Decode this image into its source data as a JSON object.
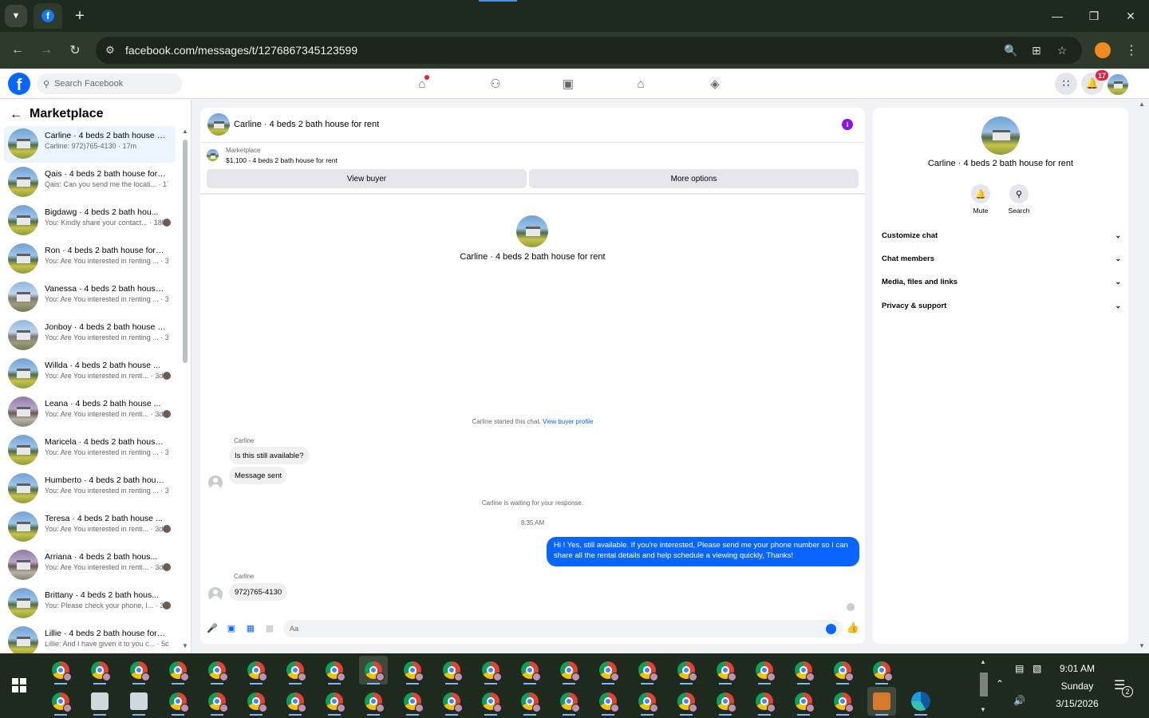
{
  "browser": {
    "url": "facebook.com/messages/t/1276867345123599",
    "icons": {
      "tab_list": "chevron-down-icon",
      "new_tab": "plus-icon",
      "minimize": "minimize-icon",
      "restore": "restore-icon",
      "close": "close-icon",
      "back": "back-arrow-icon",
      "forward": "forward-arrow-icon",
      "reload": "reload-icon",
      "zoom": "zoom-icon",
      "install": "install-app-icon",
      "bookmark": "star-icon",
      "menu": "kebab-menu-icon"
    }
  },
  "fb_header": {
    "search_placeholder": "Search Facebook",
    "notification_count": "17",
    "nav": [
      "home-icon",
      "friends-icon",
      "video-icon",
      "marketplace-icon",
      "gaming-icon"
    ],
    "brand_color": "#0866ff"
  },
  "sidebar": {
    "title": "Marketplace",
    "conversations": [
      {
        "name": "Carline · 4 beds 2 bath house f...",
        "preview": "Carline: 972)765-4130 · 17m",
        "active": true
      },
      {
        "name": "Qais · 4 beds 2 bath house for r...",
        "preview": "Qais: Can you send me the locati... · 17h"
      },
      {
        "name": "Bigdawg · 4 beds 2 bath hou...",
        "preview": "You: Kindly share your contact... · 18h"
      },
      {
        "name": "Ron · 4 beds 2 bath house for r...",
        "preview": "You: Are You interested in renting ... · 3d"
      },
      {
        "name": "Vanessa · 4 beds 2 bath house f...",
        "preview": "You: Are You interested in renting ... · 3d"
      },
      {
        "name": "Jonboy · 4 beds 2 bath house f...",
        "preview": "You: Are You interested in renting ... · 3d"
      },
      {
        "name": "Willda · 4 beds 2 bath house ...",
        "preview": "You: Are You interested in renti... · 3d"
      },
      {
        "name": "Leana · 4 beds 2 bath house ...",
        "preview": "You: Are You interested in renti... · 3d"
      },
      {
        "name": "Maricela · 4 beds 2 bath house ...",
        "preview": "You: Are You interested in renting ... · 3d"
      },
      {
        "name": "Humberto · 4 beds 2 bath hous...",
        "preview": "You: Are You interested in renting ... · 3d"
      },
      {
        "name": "Teresa · 4 beds 2 bath house ...",
        "preview": "You: Are You interested in renti... · 3d"
      },
      {
        "name": "Arriana · 4 beds 2 bath hous...",
        "preview": "You: Are You interested in renti... · 3d"
      },
      {
        "name": "Brittany · 4 beds 2 bath hous...",
        "preview": "You: Please check your phone, I... · 3d"
      },
      {
        "name": "Lillie · 4 beds 2 bath house for ...",
        "preview": "Lillie: And I have given it to you c... · 5d"
      }
    ]
  },
  "chat": {
    "title": "Carline · 4 beds 2 bath house for rent",
    "marketplace_label": "Marketplace",
    "listing": "$1,100 - 4 beds 2 bath house for rent",
    "view_buyer": "View buyer",
    "more_options": "More options",
    "intro_title": "Carline · 4 beds 2 bath house for rent",
    "started_text": "Carline started this chat.",
    "view_buyer_profile": "View buyer profile",
    "sender1": "Carline",
    "msg1": "Is this still available?",
    "msg2": "Message sent",
    "waiting_text": "Carline is waiting for your response.",
    "time": "8:35 AM",
    "outgoing": "Hi ! Yes, still available. If you're interested, Please send me your phone number so I can share all the rental details and help schedule a viewing quickly, Thanks!",
    "sender2": "Carline",
    "msg3": "972)765-4130",
    "composer_placeholder": "Aa",
    "composer_icons": [
      "microphone-icon",
      "image-icon",
      "sticker-icon",
      "gif-icon",
      "emoji-icon",
      "like-icon"
    ]
  },
  "details": {
    "title": "Carline · 4 beds 2 bath house for rent",
    "mute": "Mute",
    "search": "Search",
    "sections": [
      "Customize chat",
      "Chat members",
      "Media, files and links",
      "Privacy & support"
    ]
  },
  "taskbar": {
    "time": "9:01 AM",
    "day": "Sunday",
    "date": "3/15/2026",
    "notification_count": "2"
  }
}
